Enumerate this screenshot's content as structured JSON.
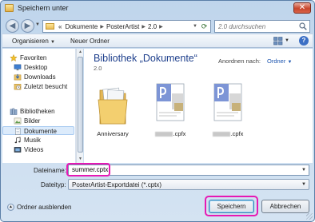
{
  "window": {
    "title": "Speichern unter",
    "close_label": "✕"
  },
  "address": {
    "root_marker": "«",
    "breadcrumbs": [
      "Dokumente",
      "PosterArtist",
      "2.0"
    ],
    "search_placeholder": "2.0 durchsuchen"
  },
  "toolbar": {
    "organize_label": "Organisieren",
    "new_folder_label": "Neuer Ordner",
    "help_label": "?"
  },
  "nav": {
    "favorites_label": "Favoriten",
    "favorites": [
      "Desktop",
      "Downloads",
      "Zuletzt besucht"
    ],
    "libraries_label": "Bibliotheken",
    "libraries": [
      "Bilder",
      "Dokumente",
      "Musik",
      "Videos"
    ],
    "selected": "Dokumente"
  },
  "content": {
    "library_title": "Bibliothek „Dokumente“",
    "library_subtitle": "2.0",
    "arrange_label": "Anordnen nach:",
    "arrange_value": "Ordner",
    "files": [
      {
        "name": "Anniversary",
        "kind": "folder"
      },
      {
        "name": ".cpfx",
        "kind": "cpfx"
      },
      {
        "name": ".cpfx",
        "kind": "cpfx"
      }
    ]
  },
  "form": {
    "filename_label": "Dateiname:",
    "filename_value": "summer.cptx",
    "filetype_label": "Dateityp:",
    "filetype_value": "PosterArtist-Exportdatei (*.cptx)"
  },
  "footer": {
    "hide_folders_label": "Ordner ausblenden",
    "save_label": "Speichern",
    "cancel_label": "Abbrechen"
  },
  "colors": {
    "highlight": "#e619b4",
    "library_title": "#1e3f8c"
  }
}
